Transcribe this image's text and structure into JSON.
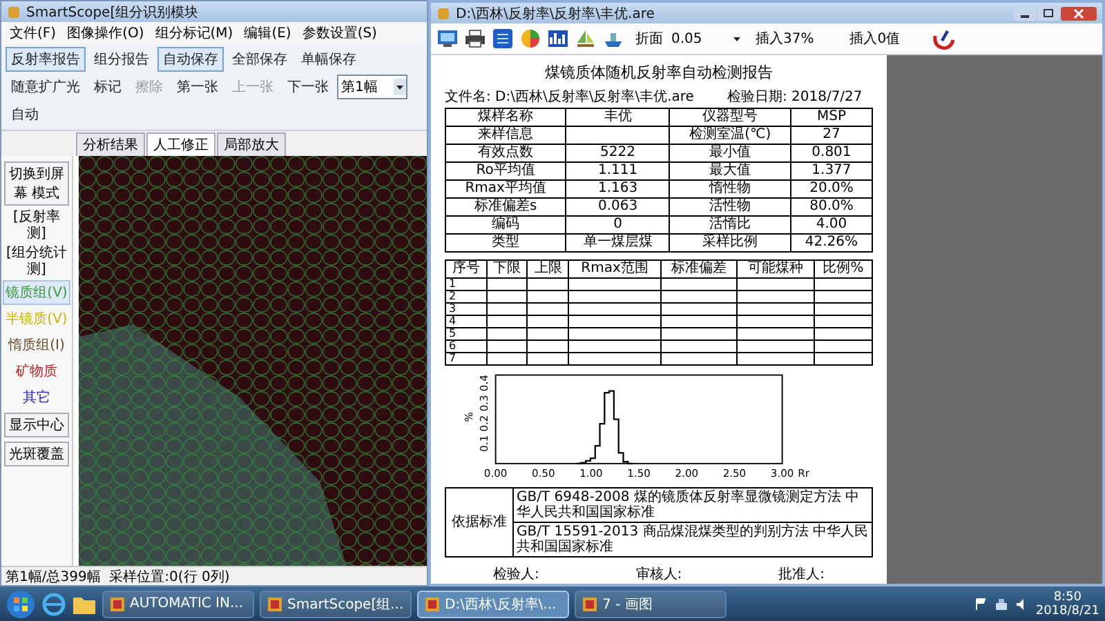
{
  "left_window": {
    "title": "SmartScope[组分识别模块",
    "menu": [
      "文件(F)",
      "图像操作(O)",
      "组分标记(M)",
      "编辑(E)",
      "参数设置(S)"
    ],
    "toolbar": [
      {
        "kind": "button",
        "label": "反射率报告",
        "selected": true,
        "disabled": false
      },
      {
        "kind": "button",
        "label": "组分报告",
        "selected": false,
        "disabled": false
      },
      {
        "kind": "button",
        "label": "自动保存",
        "selected": true,
        "disabled": false
      },
      {
        "kind": "button",
        "label": "全部保存",
        "selected": false,
        "disabled": false
      },
      {
        "kind": "button",
        "label": "单幅保存",
        "selected": false,
        "disabled": false
      },
      {
        "kind": "button",
        "label": "随意扩广光",
        "selected": false,
        "disabled": false
      },
      {
        "kind": "button",
        "label": "标记",
        "selected": false,
        "disabled": false
      },
      {
        "kind": "button",
        "label": "擦除",
        "selected": false,
        "disabled": true
      },
      {
        "kind": "button",
        "label": "第一张",
        "selected": false,
        "disabled": false
      },
      {
        "kind": "button",
        "label": "上一张",
        "selected": false,
        "disabled": true
      },
      {
        "kind": "button",
        "label": "下一张",
        "selected": false,
        "disabled": false
      },
      {
        "kind": "dropdown",
        "label": "第1幅",
        "selected": false,
        "disabled": false
      },
      {
        "kind": "button",
        "label": "自动",
        "selected": false,
        "disabled": false
      }
    ],
    "tabs": [
      {
        "label": "分析结果",
        "selected": false
      },
      {
        "label": "人工修正",
        "selected": true
      },
      {
        "label": "局部放大",
        "selected": false
      }
    ],
    "side_panel": [
      {
        "kind": "action",
        "label": "切换到屏幕 模式",
        "selected": false
      },
      {
        "kind": "header",
        "label": "[反射率测]",
        "selected": false
      },
      {
        "kind": "header",
        "label": "[组分统计测]",
        "selected": false
      },
      {
        "kind": "class",
        "label": "镜质组(V)",
        "selected": true,
        "color": "#3c9a3c"
      },
      {
        "kind": "class",
        "label": "半镜质(V)",
        "selected": false,
        "color": "#c8b400"
      },
      {
        "kind": "class",
        "label": "惰质组(I)",
        "selected": false,
        "color": "#6a4a2a"
      },
      {
        "kind": "class",
        "label": "矿物质",
        "selected": false,
        "color": "#c02020"
      },
      {
        "kind": "class",
        "label": "其它",
        "selected": false,
        "color": "#2020c0"
      },
      {
        "kind": "action",
        "label": "显示中心",
        "selected": false
      },
      {
        "kind": "action",
        "label": "光斑覆盖",
        "selected": false
      }
    ],
    "status_bar": "第1幅/总399幅  采样位置:0(行 0列)"
  },
  "report_window": {
    "title": "D:\\西林\\反射率\\反射率\\丰优.are",
    "zoom_label": "折面",
    "zoom_value": "0.05",
    "insert_buttons": [
      "插入37%",
      "插入0值"
    ],
    "report": {
      "title": "煤镜质体随机反射率自动检测报告",
      "file_line": "文件名: D:\\西林\\反射率\\反射率\\丰优.are",
      "date_line": "检验日期: 2018/7/27",
      "summary_rows": [
        [
          "煤样名称",
          "丰优",
          "仪器型号",
          "MSP"
        ],
        [
          "来样信息",
          "",
          "检测室温(℃)",
          "27"
        ],
        [
          "有效点数",
          "5222",
          "最小值",
          "0.801"
        ],
        [
          "Ro平均值",
          "1.111",
          "最大值",
          "1.377"
        ],
        [
          "Rmax平均值",
          "1.163",
          "惰性物",
          "20.0%"
        ],
        [
          "标准偏差s",
          "0.063",
          "活性物",
          "80.0%"
        ],
        [
          "编码",
          "0",
          "活惰比",
          "4.00"
        ],
        [
          "类型",
          "单一煤层煤",
          "采样比例",
          "42.26%"
        ]
      ],
      "detail_columns": [
        "序号",
        "下限",
        "上限",
        "Rmax范围",
        "标准偏差",
        "可能煤种",
        "比例%"
      ],
      "detail_rows": [
        "1",
        "2",
        "3",
        "4",
        "5",
        "6",
        "7"
      ],
      "histogram": {
        "x_label": "Rr",
        "y_label": "%",
        "x_ticks": [
          "0.00",
          "0.50",
          "1.00",
          "1.50",
          "2.00",
          "2.50",
          "3.00"
        ],
        "y_ticks": [
          "0.1",
          "0.2",
          "0.3",
          "0.4"
        ]
      },
      "standards_label": "依据标准",
      "standards": [
        "GB/T 6948-2008 煤的镜质体反射率显微镜测定方法  中华人民共和国国家标准",
        "GB/T 15591-2013 商品煤混煤类型的判别方法  中华人民共和国国家标准"
      ],
      "signatures": [
        "检验人:",
        "审核人:",
        "批准人:"
      ]
    }
  },
  "taskbar": {
    "tasks": [
      {
        "label": "AUTOMATIC IN...",
        "selected": false
      },
      {
        "label": "SmartScope[组...",
        "selected": false
      },
      {
        "label": "D:\\西林\\反射率\\...",
        "selected": true
      },
      {
        "label": "7 - 画图",
        "selected": false
      }
    ],
    "time": "8:50",
    "date": "2018/8/21"
  }
}
